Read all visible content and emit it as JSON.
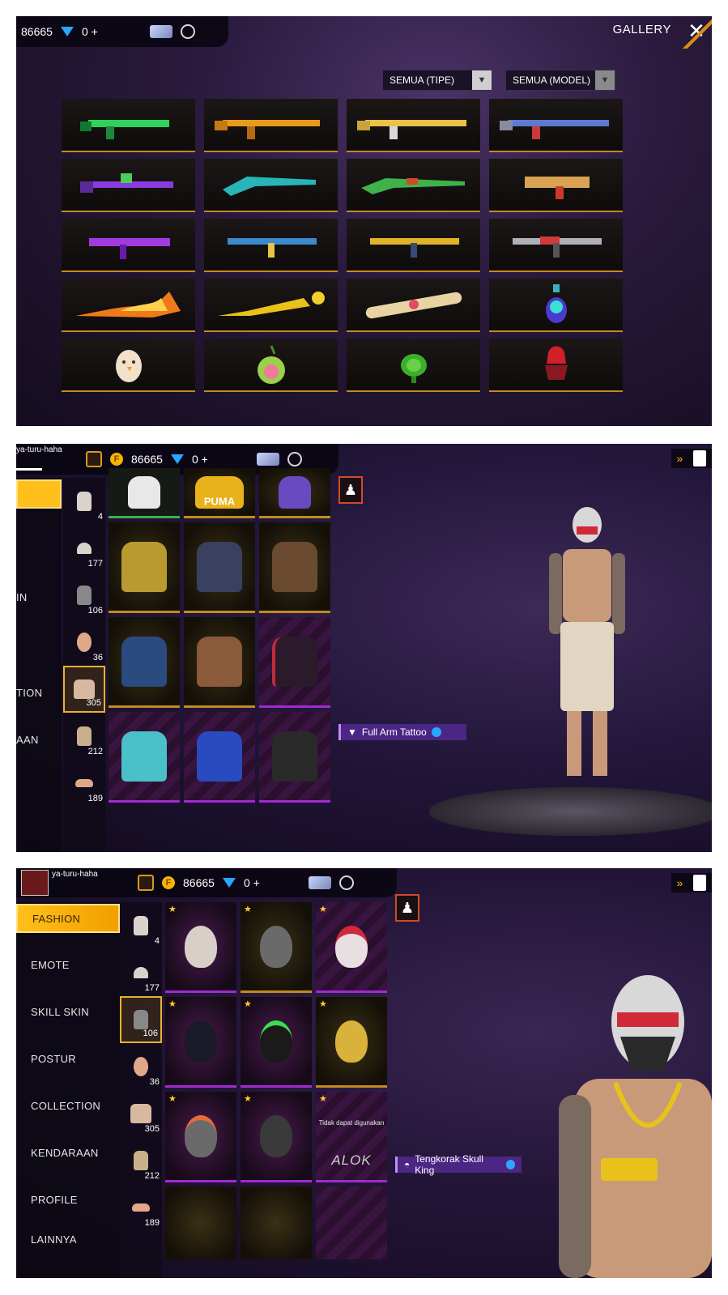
{
  "colors": {
    "gold": "#c48a1c",
    "purple_rarity": "#a02ad0",
    "menu_active": "#ffbf1a"
  },
  "panel1": {
    "coins": "86665",
    "diamonds": "0 +",
    "title": "GALLERY",
    "filter_type": "SEMUA (TIPE)",
    "filter_model": "SEMUA (MODEL)",
    "items": [
      {
        "name": "green-rifle"
      },
      {
        "name": "orange-rifle"
      },
      {
        "name": "gold-white-rifle"
      },
      {
        "name": "blue-red-rifle"
      },
      {
        "name": "purple-rifle"
      },
      {
        "name": "teal-sniper"
      },
      {
        "name": "green-sniper"
      },
      {
        "name": "gold-smg"
      },
      {
        "name": "purple-smg"
      },
      {
        "name": "blue-smg"
      },
      {
        "name": "gold-smg-2"
      },
      {
        "name": "red-smg"
      },
      {
        "name": "flame-blade"
      },
      {
        "name": "yellow-umbrella"
      },
      {
        "name": "rolling-pin"
      },
      {
        "name": "potion-grenade"
      },
      {
        "name": "egg-grenade"
      },
      {
        "name": "melon-grenade"
      },
      {
        "name": "green-turtle-grenade"
      },
      {
        "name": "red-grenade"
      }
    ]
  },
  "panel2": {
    "username": "ya-turu-haha",
    "coins": "86665",
    "diamonds": "0 +",
    "menu_partial": [
      "IN",
      "TION",
      "AAN"
    ],
    "categories": [
      {
        "icon": "shirt-icon",
        "count": "4"
      },
      {
        "icon": "cap-icon",
        "count": "177"
      },
      {
        "icon": "mask-icon",
        "count": "106"
      },
      {
        "icon": "head-icon",
        "count": "36"
      },
      {
        "icon": "torso-icon",
        "count": "305"
      },
      {
        "icon": "pants-icon",
        "count": "212"
      },
      {
        "icon": "shoes-icon",
        "count": "189"
      }
    ],
    "brand_text": "PUMA",
    "selected_item": "Full Arm Tattoo"
  },
  "panel3": {
    "username": "ya-turu-haha",
    "coins": "86665",
    "diamonds": "0 +",
    "menu": [
      "FASHION",
      "EMOTE",
      "SKILL SKIN",
      "POSTUR",
      "COLLECTION",
      "KENDARAAN",
      "PROFILE",
      "LAINNYA"
    ],
    "categories": [
      {
        "icon": "shirt-icon",
        "count": "4"
      },
      {
        "icon": "cap-icon",
        "count": "177"
      },
      {
        "icon": "mask-icon",
        "count": "106"
      },
      {
        "icon": "head-icon",
        "count": "36"
      },
      {
        "icon": "torso-icon",
        "count": "305"
      },
      {
        "icon": "pants-icon",
        "count": "212"
      },
      {
        "icon": "shoes-icon",
        "count": "189"
      }
    ],
    "not_usable_text": "Tidak dapat digunakan",
    "alok_text": "ALOK",
    "selected_item": "Tengkorak Skull King"
  }
}
